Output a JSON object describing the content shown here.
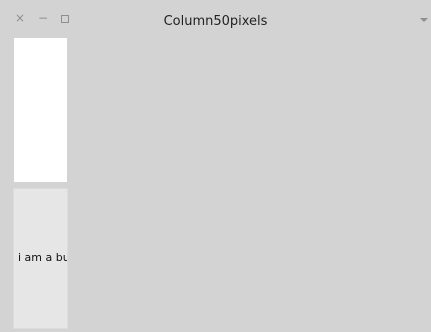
{
  "window": {
    "title": "Column50pixels",
    "close_glyph": "×",
    "minimize_glyph": "−"
  },
  "column": {
    "button_label": "i am a button"
  }
}
